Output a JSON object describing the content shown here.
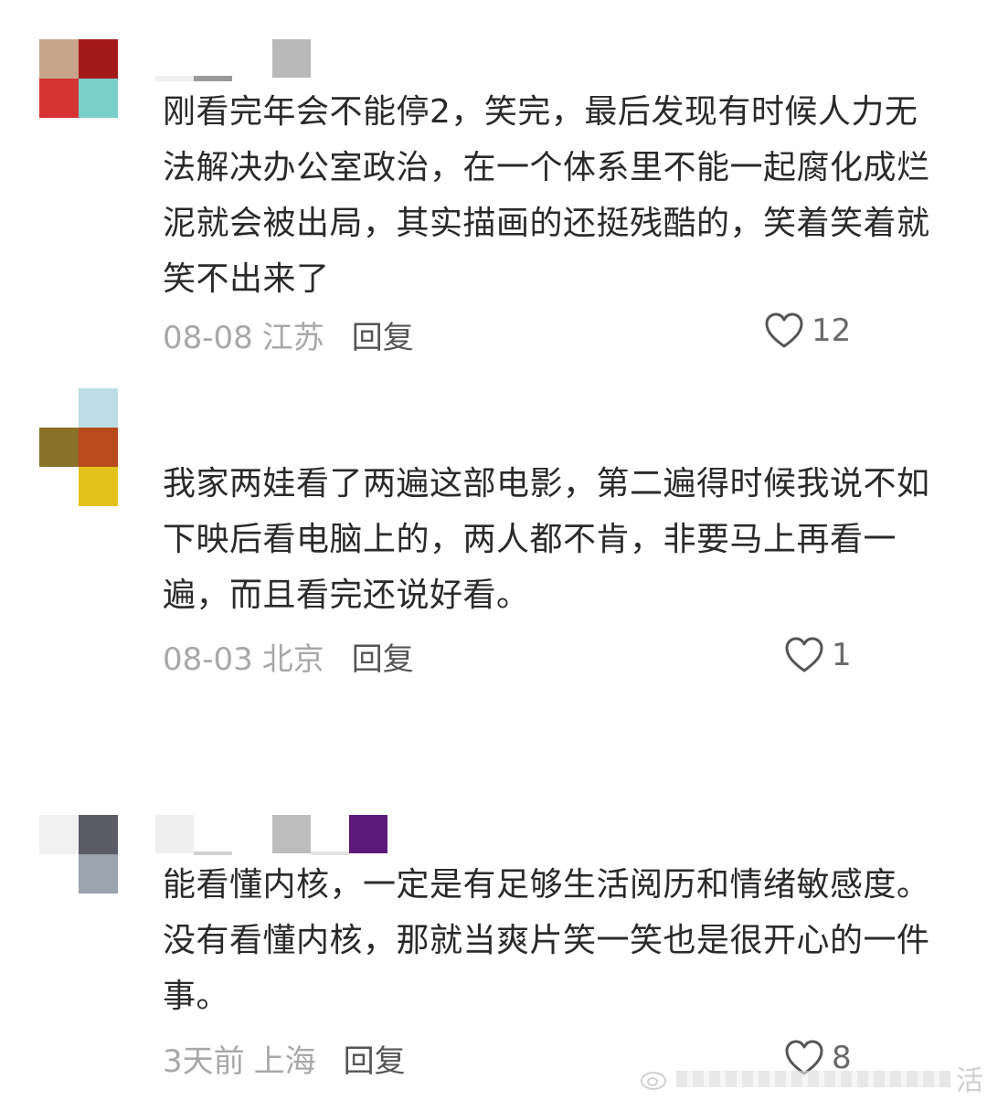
{
  "comments": [
    {
      "text": "刚看完年会不能停2，笑完，最后发现有时候人力无法解决办公室政治，在一个体系里不能一起腐化成烂泥就会被出局，其实描画的还挺残酷的，笑着笑着就笑不出来了",
      "date": "08-08",
      "region": "江苏",
      "reply_label": "回复",
      "likes": "12",
      "avatar_colors": [
        "#c8a58a",
        "#a41a1a",
        "#d63434",
        "#79d0c9"
      ]
    },
    {
      "text": "我家两娃看了两遍这部电影，第二遍得时候我说不如下映后看电脑上的，两人都不肯，非要马上再看一遍，而且看完还说好看。",
      "date": "08-03",
      "region": "北京",
      "reply_label": "回复",
      "likes": "1",
      "avatar_colors": [
        "#ffffff",
        "#bcdde4",
        "#8a7128",
        "#b84a1c",
        "#ffffff",
        "#e3c21c"
      ]
    },
    {
      "text": "能看懂内核，一定是有足够生活阅历和情绪敏感度。没有看懂内核，那就当爽片笑一笑也是很开心的一件事。",
      "date": "3天前",
      "region": "上海",
      "reply_label": "回复",
      "likes": "8",
      "avatar_colors": [
        "#f1f1f1",
        "#5b5b66",
        "#ffffff",
        "#9aa3ae"
      ]
    }
  ],
  "namebar_colors": {
    "c1": [
      "#f2f2f2",
      "#ffffff",
      "#b9b9b9"
    ],
    "c3": [
      "#efefef",
      "#ffffff",
      "#bdbdbd",
      "#eeeeee",
      "#5a1a78"
    ]
  },
  "watermark_char": "活"
}
